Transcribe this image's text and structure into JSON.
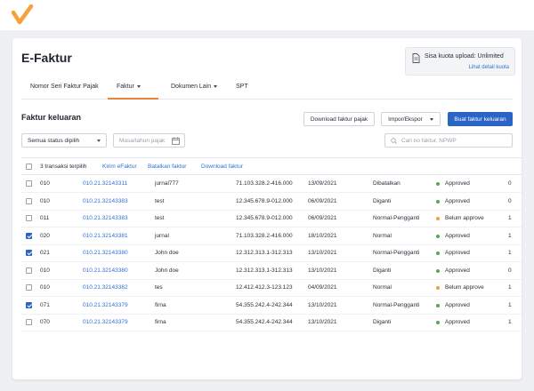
{
  "app": {
    "title": "E-Faktur",
    "brand_color": "#f5a23c",
    "accent_color": "#2a64c5"
  },
  "quota": {
    "label": "Sisa kuota upload: Unlimited",
    "link": "Lihat detail kuota",
    "icon": "document-icon"
  },
  "tabs": [
    {
      "label": "Nomor Seri Faktur Pajak",
      "has_menu": false
    },
    {
      "label": "Faktur",
      "has_menu": true,
      "active": true
    },
    {
      "label": "Dokumen Lain",
      "has_menu": true
    },
    {
      "label": "SPT",
      "has_menu": false
    }
  ],
  "section": {
    "title": "Faktur keluaran"
  },
  "toolbar": {
    "download_label": "Download faktur pajak",
    "import_label": "Impor/Ekspor",
    "create_label": "Buat faktur keluaran"
  },
  "filters": {
    "status_value": "Semua status dipilih",
    "period_placeholder": "Masa/tahun pajak",
    "search_placeholder": "Cari no faktur, NPWP"
  },
  "bulk": {
    "selected": "3 transaksi terpilih",
    "actions": [
      "Kirim eFaktur",
      "Batalkan faktur",
      "Download faktur"
    ]
  },
  "status_colors": {
    "Approved": "#4caf50",
    "Belum approve": "#f0a04b"
  },
  "rows": [
    {
      "checked": false,
      "code": "010",
      "number": "010.21.32143311",
      "name": "jurnal777",
      "npwp": "71.103.328.2-416.000",
      "date": "13/09/2021",
      "type": "Dibatalkan",
      "status": "Approved",
      "extra": "0"
    },
    {
      "checked": false,
      "code": "010",
      "number": "010.21.32143383",
      "name": "test",
      "npwp": "12.345.678.9-012.000",
      "date": "06/09/2021",
      "type": "Diganti",
      "status": "Approved",
      "extra": "0"
    },
    {
      "checked": false,
      "code": "011",
      "number": "010.21.32143383",
      "name": "test",
      "npwp": "12.345.678.9-012.000",
      "date": "06/09/2021",
      "type": "Normal-Pengganti",
      "status": "Belum approve",
      "extra": "1"
    },
    {
      "checked": true,
      "code": "020",
      "number": "010.21.32143381",
      "name": "jurnal",
      "npwp": "71.103.328.2-416.000",
      "date": "18/10/2021",
      "type": "Normal",
      "status": "Approved",
      "extra": "1"
    },
    {
      "checked": true,
      "code": "021",
      "number": "010.21.32143380",
      "name": "John doe",
      "npwp": "12.312.313.1-312.313",
      "date": "13/10/2021",
      "type": "Normal-Pengganti",
      "status": "Approved",
      "extra": "1"
    },
    {
      "checked": false,
      "code": "010",
      "number": "010.21.32143380",
      "name": "John doe",
      "npwp": "12.312.313.1-312.313",
      "date": "13/10/2021",
      "type": "Diganti",
      "status": "Approved",
      "extra": "0"
    },
    {
      "checked": false,
      "code": "010",
      "number": "010.21.32143382",
      "name": "tes",
      "npwp": "12.412.412.3-123.123",
      "date": "04/09/2021",
      "type": "Normal",
      "status": "Belum approve",
      "extra": "1"
    },
    {
      "checked": true,
      "code": "071",
      "number": "010.21.32143379",
      "name": "firna",
      "npwp": "54.355.242.4-242.344",
      "date": "13/10/2021",
      "type": "Normal-Pengganti",
      "status": "Approved",
      "extra": "1"
    },
    {
      "checked": false,
      "code": "070",
      "number": "010.21.32143379",
      "name": "firna",
      "npwp": "54.355.242.4-242.344",
      "date": "13/10/2021",
      "type": "Diganti",
      "status": "Approved",
      "extra": "1"
    }
  ]
}
